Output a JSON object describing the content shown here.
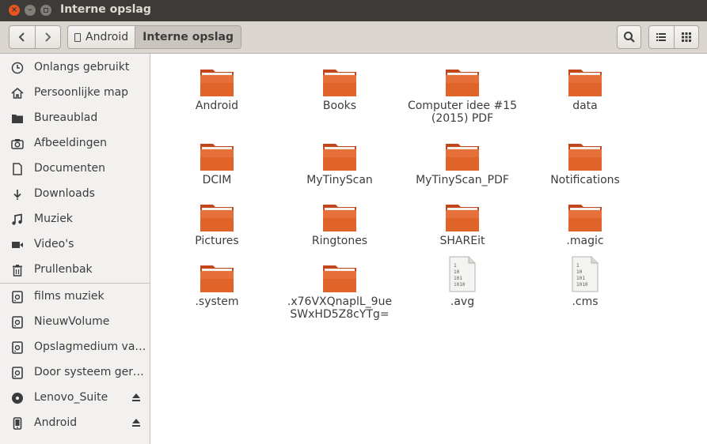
{
  "window": {
    "title": "Interne opslag"
  },
  "toolbar": {
    "back_icon": "chevron-left-icon",
    "forward_icon": "chevron-right-icon",
    "breadcrumbs": [
      "Android",
      "Interne opslag"
    ],
    "search_icon": "search-icon",
    "list_view_icon": "list-view-icon",
    "grid_view_icon": "grid-view-icon"
  },
  "sidebar": {
    "places": [
      {
        "label": "Onlangs gebruikt",
        "icon": "clock-icon"
      },
      {
        "label": "Persoonlijke map",
        "icon": "home-icon"
      },
      {
        "label": "Bureaublad",
        "icon": "folder-icon"
      },
      {
        "label": "Afbeeldingen",
        "icon": "camera-icon"
      },
      {
        "label": "Documenten",
        "icon": "document-icon"
      },
      {
        "label": "Downloads",
        "icon": "download-icon"
      },
      {
        "label": "Muziek",
        "icon": "music-icon"
      },
      {
        "label": "Video's",
        "icon": "video-icon"
      },
      {
        "label": "Prullenbak",
        "icon": "trash-icon"
      }
    ],
    "devices": [
      {
        "label": "films muziek",
        "icon": "drive-icon",
        "eject": false
      },
      {
        "label": "NieuwVolume",
        "icon": "drive-icon",
        "eject": false
      },
      {
        "label": "Opslagmedium van…",
        "icon": "drive-icon",
        "eject": false
      },
      {
        "label": "Door systeem gere…",
        "icon": "drive-icon",
        "eject": false
      },
      {
        "label": "Lenovo_Suite",
        "icon": "disc-icon",
        "eject": true
      },
      {
        "label": "Android",
        "icon": "phone-icon",
        "eject": true
      }
    ]
  },
  "files": [
    {
      "name": "Android",
      "type": "folder"
    },
    {
      "name": "Books",
      "type": "folder"
    },
    {
      "name": "Computer idee #15 (2015) PDF",
      "type": "folder"
    },
    {
      "name": "data",
      "type": "folder"
    },
    {
      "name": "DCIM",
      "type": "folder"
    },
    {
      "name": "MyTinyScan",
      "type": "folder"
    },
    {
      "name": "MyTinyScan_PDF",
      "type": "folder"
    },
    {
      "name": "Notifications",
      "type": "folder"
    },
    {
      "name": "Pictures",
      "type": "folder"
    },
    {
      "name": "Ringtones",
      "type": "folder"
    },
    {
      "name": "SHAREit",
      "type": "folder"
    },
    {
      "name": ".magic",
      "type": "folder"
    },
    {
      "name": ".system",
      "type": "folder"
    },
    {
      "name": ".x76VXQnaplL_9ueSWxHD5Z8cYTg=",
      "type": "folder"
    },
    {
      "name": ".avg",
      "type": "binary-file"
    },
    {
      "name": ".cms",
      "type": "binary-file"
    }
  ],
  "colors": {
    "titlebar": "#3c3b37",
    "close_button": "#e95420",
    "folder_orange": "#e0632a",
    "toolbar": "#dad6cf",
    "sidebar": "#f2f1ef"
  }
}
